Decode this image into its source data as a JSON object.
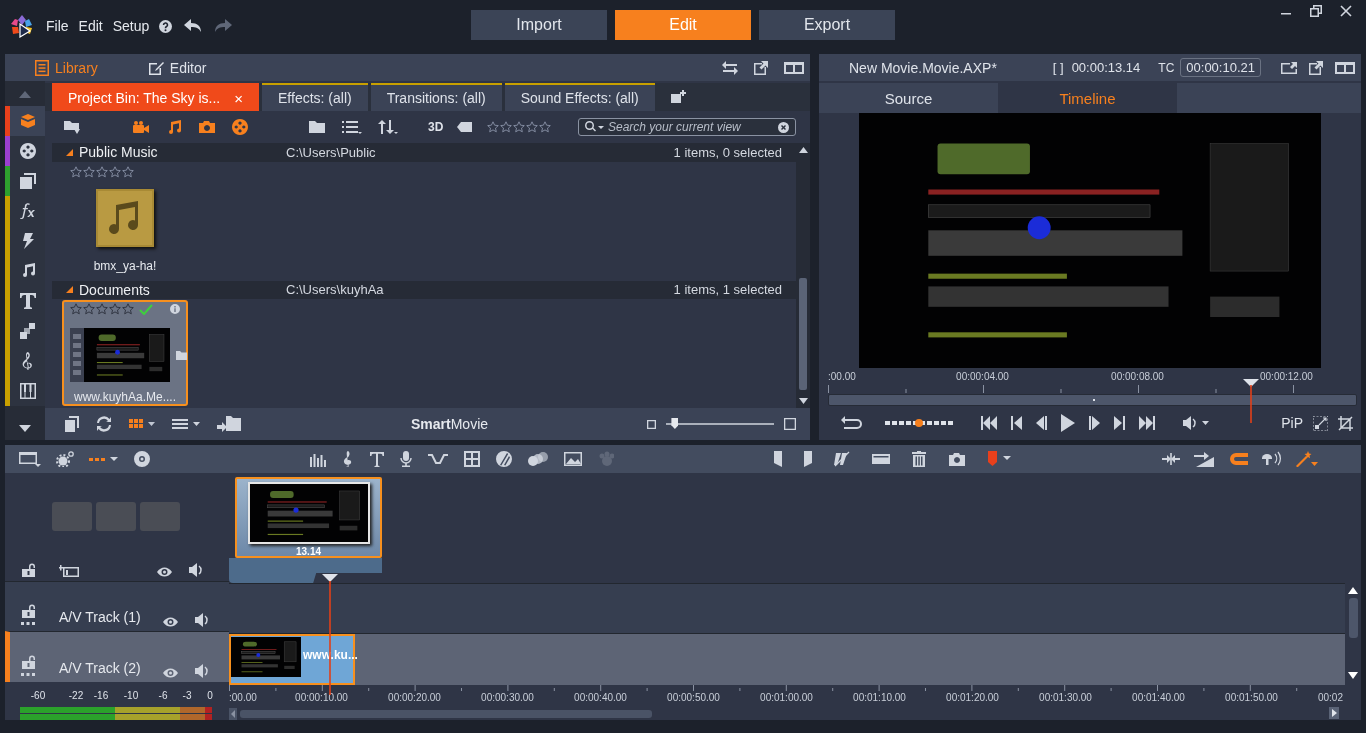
{
  "menu": {
    "items": [
      "File",
      "Edit",
      "Setup"
    ]
  },
  "mode_buttons": [
    {
      "label": "Import",
      "selected": false
    },
    {
      "label": "Edit",
      "selected": true
    },
    {
      "label": "Export",
      "selected": false
    }
  ],
  "library": {
    "views": [
      {
        "label": "Library",
        "selected": true
      },
      {
        "label": "Editor",
        "selected": false
      }
    ],
    "sidebar": [
      {
        "selected": true,
        "color": "#e8401c"
      },
      {
        "selected": false,
        "color": "#9b3fd0"
      },
      {
        "selected": false,
        "color": "#2ea02e"
      },
      {
        "selected": false,
        "color": "#c8a000"
      },
      {
        "selected": false,
        "color": "#c8a000"
      },
      {
        "selected": false,
        "color": "#c8a000"
      },
      {
        "selected": false,
        "color": "#c8a000"
      },
      {
        "selected": false,
        "color": "#c8a000"
      },
      {
        "selected": false,
        "color": "#c8a000"
      },
      {
        "selected": false,
        "color": "#c8a000"
      }
    ],
    "tabs": [
      {
        "label": "Project Bin: The Sky is...",
        "selected": true,
        "close": "×"
      },
      {
        "label": "Effects: (all)",
        "selected": false
      },
      {
        "label": "Transitions: (all)",
        "selected": false
      },
      {
        "label": "Sound Effects: (all)",
        "selected": false
      }
    ],
    "toolbar": {
      "view_label": "3D",
      "stars": 0,
      "search": {
        "placeholder": "Search your current view"
      }
    },
    "groups": [
      {
        "name": "Public Music",
        "path": "C:\\Users\\Public",
        "count": "1 items, 0 selected",
        "items": [
          {
            "kind": "audio",
            "name": "bmx_ya-ha!",
            "stars": 0,
            "selected": false,
            "in_project": false
          }
        ]
      },
      {
        "name": "Documents",
        "path": "C:\\Users\\kuyhAa",
        "count": "1 items, 1 selected",
        "items": [
          {
            "kind": "video",
            "name": "www.kuyhAa.Me....",
            "stars": 0,
            "selected": true,
            "in_project": true
          }
        ]
      }
    ],
    "smartmovie": "**Smart**Movie",
    "zoom_slider": {
      "level": 0.05
    }
  },
  "preview": {
    "title": "New Movie.Movie.AXP*",
    "duration_mark": "[ ]",
    "duration": "00:00:13.14",
    "tc_label": "TC",
    "timecode": "00:00:10.21",
    "tabs": [
      {
        "label": "Source",
        "selected": false
      },
      {
        "label": "Timeline",
        "selected": true
      }
    ],
    "ruler": [
      ":00.00",
      "00:00:04.00",
      "00:00:08.00",
      "00:00:12.00"
    ],
    "scrubber": {
      "level": 0.8
    },
    "shuttle": {
      "level": 0.5
    },
    "pip_label": "PiP"
  },
  "timeline": {
    "title_clip": {
      "label": "13.14"
    },
    "tracks": [
      {
        "name": "A/V Track (1)",
        "selected": false
      },
      {
        "name": "A/V Track (2)",
        "selected": true,
        "clip": {
          "label": "www.ku..."
        }
      }
    ],
    "meter_scale": [
      "-60",
      "-22",
      "-16",
      "-10",
      "-6",
      "-3",
      "0"
    ],
    "ruler": [
      ":00.00",
      "00:00:10.00",
      "00:00:20.00",
      "00:00:30.00",
      "00:00:40.00",
      "00:00:50.00",
      "00:01:00.00",
      "00:01:10.00",
      "00:01:20.00",
      "00:01:30.00",
      "00:01:40.00",
      "00:01:50.00",
      "00:02"
    ],
    "playhead": {
      "level": 0.091
    }
  }
}
